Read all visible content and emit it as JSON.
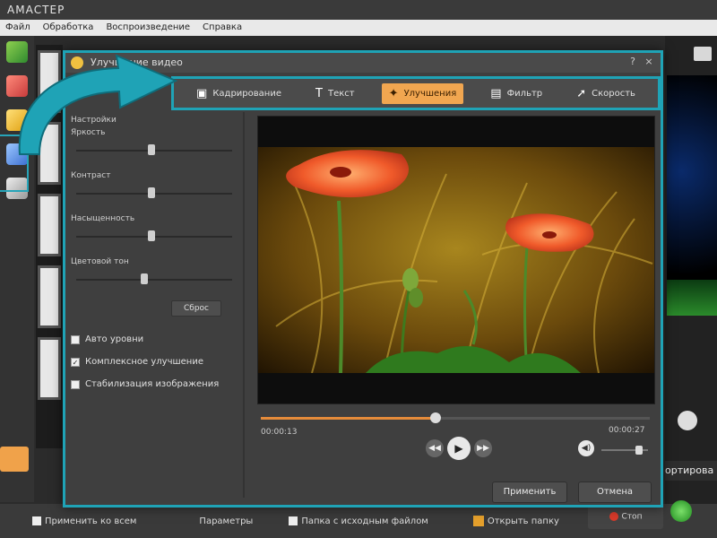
{
  "app": {
    "title": "АМАСТЕР",
    "menu": [
      "Файл",
      "Обработка",
      "Воспроизведение",
      "Справка"
    ]
  },
  "left_toolbar": {
    "items": [
      {
        "label": "",
        "icon": "green-effect-icon"
      },
      {
        "label": "",
        "icon": "red-text-icon"
      },
      {
        "label": "",
        "icon": "yellow-enhance-icon"
      },
      {
        "label": "",
        "icon": "blue-transition-icon"
      },
      {
        "label": "",
        "icon": "grey-export-icon"
      }
    ],
    "orange_button": "",
    "bottom_label": ""
  },
  "dialog": {
    "title": "Улучшение видео",
    "help_icon": "?",
    "close_icon": "×",
    "tabs": [
      {
        "label": "Кадрирование",
        "icon": "crop-icon",
        "active": false
      },
      {
        "label": "Текст",
        "icon": "text-icon",
        "active": false
      },
      {
        "label": "Улучшения",
        "icon": "magic-wand-icon",
        "active": true
      },
      {
        "label": "Фильтр",
        "icon": "film-icon",
        "active": false
      },
      {
        "label": "Скорость",
        "icon": "runner-icon",
        "active": false
      }
    ],
    "controls": {
      "section_label": "Настройки",
      "sliders": [
        {
          "label": "Яркость",
          "value": 0.5
        },
        {
          "label": "Контраст",
          "value": 0.5
        },
        {
          "label": "Насыщенность",
          "value": 0.5
        },
        {
          "label": "Цветовой тон",
          "value": 0.45
        }
      ],
      "reset_label": "Сброс",
      "checkboxes": [
        {
          "label": "Авто уровни",
          "checked": false
        },
        {
          "label": "Комплексное улучшение",
          "checked": true
        },
        {
          "label": "Стабилизация изображения",
          "checked": false
        }
      ]
    },
    "player": {
      "time_current": "00:00:13",
      "time_total": "00:00:27",
      "progress": 0.45,
      "volume": 0.8,
      "prev": "◀◀",
      "play": "▶",
      "next": "▶▶",
      "vol_glyph": "◀)"
    },
    "apply_label": "Применить",
    "cancel_label": "Отмена"
  },
  "bottom_bar": {
    "items": [
      "Применить ко всем",
      "Параметры",
      "Папка с исходным файлом",
      "Открыть папку"
    ]
  },
  "right_panel": {
    "label": "ортирова",
    "red_button": "Стоп"
  },
  "colors": {
    "accent_teal": "#1fa3b6",
    "active_tab": "#f1a650",
    "progress": "#e58b3a"
  }
}
